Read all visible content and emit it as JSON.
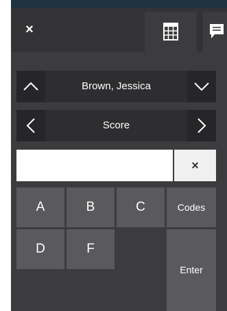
{
  "header": {
    "close_symbol": "×",
    "tabs": [
      {
        "icon": "grid-icon",
        "active": true
      },
      {
        "icon": "comment-icon",
        "active": false
      }
    ]
  },
  "student_nav": {
    "label": "Brown, Jessica",
    "prev_icon": "chevron-up-icon",
    "next_icon": "chevron-down-icon"
  },
  "column_nav": {
    "label": "Score",
    "prev_icon": "chevron-left-icon",
    "next_icon": "chevron-right-icon"
  },
  "entry": {
    "value": "",
    "placeholder": "",
    "clear_symbol": "×"
  },
  "keypad": {
    "keys": [
      "A",
      "B",
      "C",
      "D",
      "F"
    ],
    "codes_label": "Codes",
    "enter_label": "Enter"
  },
  "colors": {
    "panel": "#3c3c3e",
    "topbar": "#333335",
    "accent_strip": "#1e3441",
    "key": "#5a5a5d",
    "nav_button": "#262628"
  }
}
